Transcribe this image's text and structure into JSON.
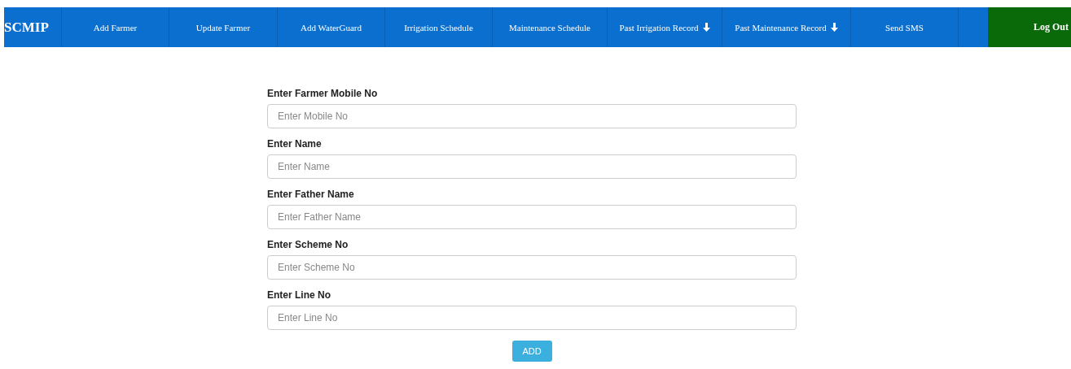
{
  "navbar": {
    "brand": "SCMIP",
    "items": [
      {
        "label": "Add Farmer",
        "dropdown": false
      },
      {
        "label": "Update Farmer",
        "dropdown": false
      },
      {
        "label": "Add WaterGuard",
        "dropdown": false
      },
      {
        "label": "Irrigation Schedule",
        "dropdown": false
      },
      {
        "label": "Maintenance Schedule",
        "dropdown": false
      },
      {
        "label": "Past Irrigation Record",
        "dropdown": true
      },
      {
        "label": "Past Maintenance Record",
        "dropdown": true
      },
      {
        "label": "Send SMS",
        "dropdown": false
      }
    ],
    "logout": "Log Out"
  },
  "form": {
    "fields": [
      {
        "label": "Enter Farmer Mobile No",
        "placeholder": "Enter Mobile No"
      },
      {
        "label": "Enter Name",
        "placeholder": "Enter Name"
      },
      {
        "label": "Enter Father Name",
        "placeholder": "Enter Father Name"
      },
      {
        "label": "Enter Scheme No",
        "placeholder": "Enter Scheme No"
      },
      {
        "label": "Enter Line No",
        "placeholder": "Enter Line No"
      }
    ],
    "submit": "ADD"
  }
}
